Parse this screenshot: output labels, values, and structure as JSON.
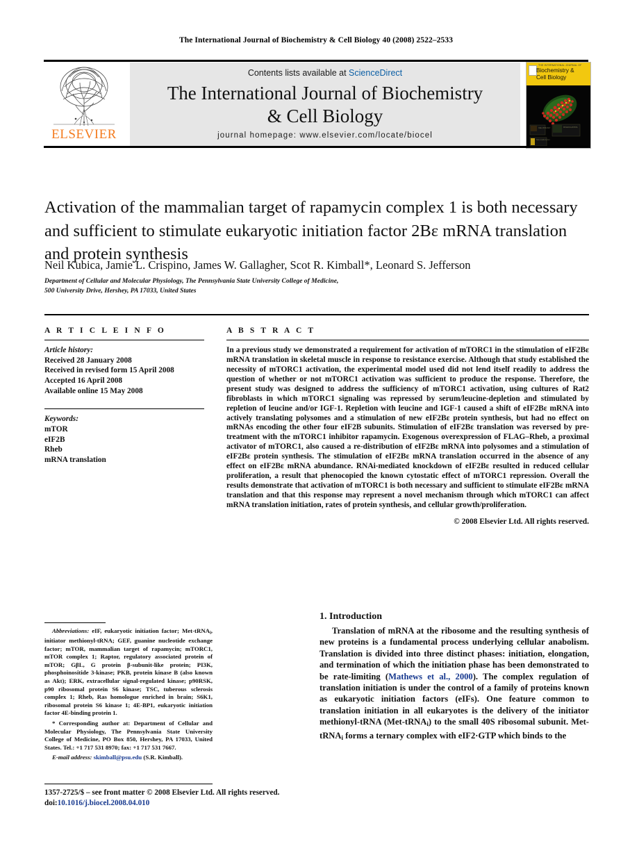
{
  "running_head": "The International Journal of Biochemistry & Cell Biology 40 (2008) 2522–2533",
  "masthead": {
    "publisher": "ELSEVIER",
    "contents_prefix": "Contents lists available at ",
    "contents_link": "ScienceDirect",
    "journal_title_line1": "The International Journal of Biochemistry",
    "journal_title_line2": "& Cell Biology",
    "homepage": "journal homepage: www.elsevier.com/locate/biocel",
    "cover": {
      "tiny_line": "THE INTERNATIONAL JOURNAL OF",
      "name_line1": "Biochemistry &",
      "name_line2": "Cell Biology"
    }
  },
  "article": {
    "title": "Activation of the mammalian target of rapamycin complex 1 is both necessary and sufficient to stimulate eukaryotic initiation factor 2Bε mRNA translation and protein synthesis",
    "authors": "Neil Kubica, Jamie L. Crispino, James W. Gallagher, Scot R. Kimball*, Leonard S. Jefferson",
    "affiliation_line1": "Department of Cellular and Molecular Physiology, The Pennsylvania State University College of Medicine,",
    "affiliation_line2": "500 University Drive, Hershey, PA 17033, United States"
  },
  "article_info": {
    "heading": "A R T I C L E   I N F O",
    "history_label": "Article history:",
    "history": [
      "Received 28 January 2008",
      "Received in revised form 15 April 2008",
      "Accepted 16 April 2008",
      "Available online 15 May 2008"
    ],
    "keywords_label": "Keywords:",
    "keywords": [
      "mTOR",
      "eIF2B",
      "Rheb",
      "mRNA translation"
    ]
  },
  "abstract": {
    "heading": "A B S T R A C T",
    "text": "In a previous study we demonstrated a requirement for activation of mTORC1 in the stimulation of eIF2Bε mRNA translation in skeletal muscle in response to resistance exercise. Although that study established the necessity of mTORC1 activation, the experimental model used did not lend itself readily to address the question of whether or not mTORC1 activation was sufficient to produce the response. Therefore, the present study was designed to address the sufficiency of mTORC1 activation, using cultures of Rat2 fibroblasts in which mTORC1 signaling was repressed by serum/leucine-depletion and stimulated by repletion of leucine and/or IGF-1. Repletion with leucine and IGF-1 caused a shift of eIF2Bε mRNA into actively translating polysomes and a stimulation of new eIF2Bε protein synthesis, but had no effect on mRNAs encoding the other four eIF2B subunits. Stimulation of eIF2Bε translation was reversed by pre-treatment with the mTORC1 inhibitor rapamycin. Exogenous overexpression of FLAG–Rheb, a proximal activator of mTORC1, also caused a re-distribution of eIF2Bε mRNA into polysomes and a stimulation of eIF2Bε protein synthesis. The stimulation of eIF2Bε mRNA translation occurred in the absence of any effect on eIF2Bε mRNA abundance. RNAi-mediated knockdown of eIF2Bε resulted in reduced cellular proliferation, a result that phenocopied the known cytostatic effect of mTORC1 repression. Overall the results demonstrate that activation of mTORC1 is both necessary and sufficient to stimulate eIF2Bε mRNA translation and that this response may represent a novel mechanism through which mTORC1 can affect mRNA translation initiation, rates of protein synthesis, and cellular growth/proliferation.",
    "copyright": "© 2008 Elsevier Ltd. All rights reserved."
  },
  "footnotes": {
    "abbreviations_label": "Abbreviations:",
    "abbreviations_text": " eIF, eukaryotic initiation factor; Met-tRNAi, initiator methionyl-tRNA; GEF, guanine nucleotide exchange factor; mTOR, mammalian target of rapamycin; mTORC1, mTOR complex 1; Raptor, regulatory associated protein of mTOR; GβL, G protein β-subunit-like protein; PI3K, phosphoinositide 3-kinase; PKB, protein kinase B (also known as Akt); ERK, extracellular signal-regulated kinase; p90RSK, p90 ribosomal protein S6 kinase; TSC, tuberous sclerosis complex 1; Rheb, Ras homologue enriched in brain; S6K1, ribosomal protein S6 kinase 1; 4E-BP1, eukaryotic initiation factor 4E-binding protein 1.",
    "corresponding_marker": "*",
    "corresponding_text": " Corresponding author at: Department of Cellular and Molecular Physiology, The Pennsylvania State University College of Medicine, PO Box 850, Hershey, PA 17033, United States. Tel.: +1 717 531 8970; fax: +1 717 531 7667.",
    "email_label": "E-mail address:",
    "email_address": "skimball@psu.edu",
    "email_owner": " (S.R. Kimball)."
  },
  "introduction": {
    "heading": "1. Introduction",
    "paragraph_part1": "Translation of mRNA at the ribosome and the resulting synthesis of new proteins is a fundamental process underlying cellular anabolism. Translation is divided into three distinct phases: initiation, elongation, and termination of which the initiation phase has been demonstrated to be rate-limiting (",
    "citation": "Mathews et al., 2000",
    "paragraph_part2": "). The complex regulation of translation initiation is under the control of a family of proteins known as eukaryotic initiation factors (eIFs). One feature common to translation initiation in all eukaryotes is the delivery of the initiator methionyl-tRNA (Met-tRNAi) to the small 40S ribosomal subunit. Met-tRNAi forms a ternary complex with eIF2·GTP which binds to the"
  },
  "colophon": {
    "issn_line": "1357-2725/$ – see front matter © 2008 Elsevier Ltd. All rights reserved.",
    "doi_label": "doi:",
    "doi": "10.1016/j.biocel.2008.04.010"
  },
  "colors": {
    "link": "#17398f",
    "sciencedirect": "#0b5fa5",
    "elsevier_orange": "#F47C20",
    "band_gray": "#e6e6e6",
    "cover_yellow": "#f2c80f"
  }
}
